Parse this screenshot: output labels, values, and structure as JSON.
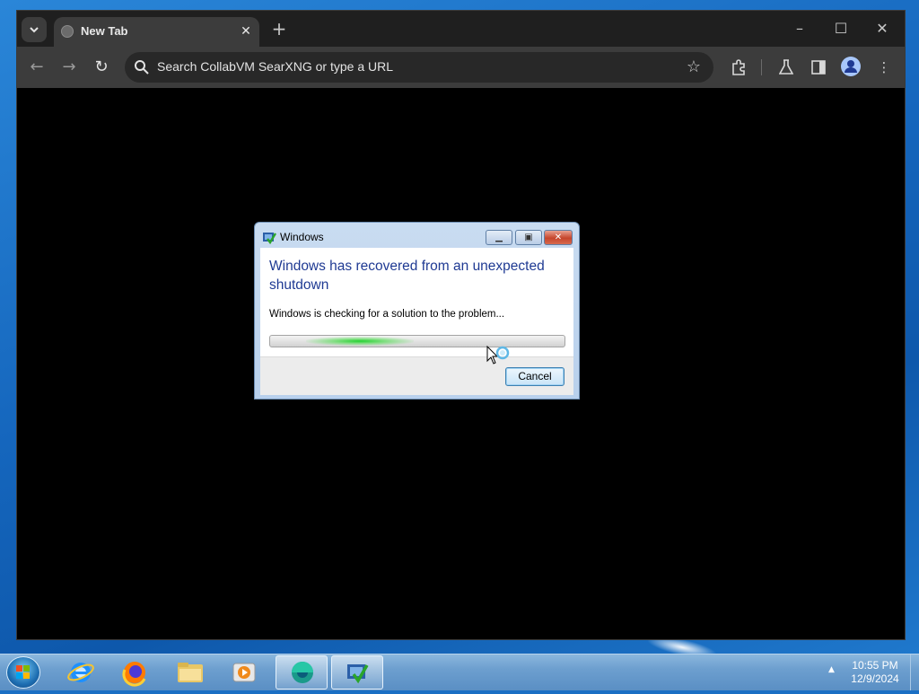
{
  "browser": {
    "tab": {
      "title": "New Tab"
    },
    "omnibox": {
      "placeholder": "Search CollabVM SearXNG or type a URL"
    }
  },
  "dialog": {
    "window_title": "Windows",
    "heading": "Windows has recovered from an unexpected shutdown",
    "message": "Windows is checking for a solution to the problem...",
    "cancel_label": "Cancel",
    "progress": "indeterminate"
  },
  "taskbar": {
    "items": [
      "start-button",
      "internet-explorer-icon",
      "firefox-icon",
      "file-explorer-icon",
      "media-player-icon",
      "browser-app-icon",
      "problem-reports-icon"
    ],
    "clock": {
      "time": "10:55 PM",
      "date": "12/9/2024"
    }
  },
  "colors": {
    "heading_blue": "#1f3a93",
    "progress_green": "#22d12f",
    "chrome_dark": "#1f1f1f"
  }
}
